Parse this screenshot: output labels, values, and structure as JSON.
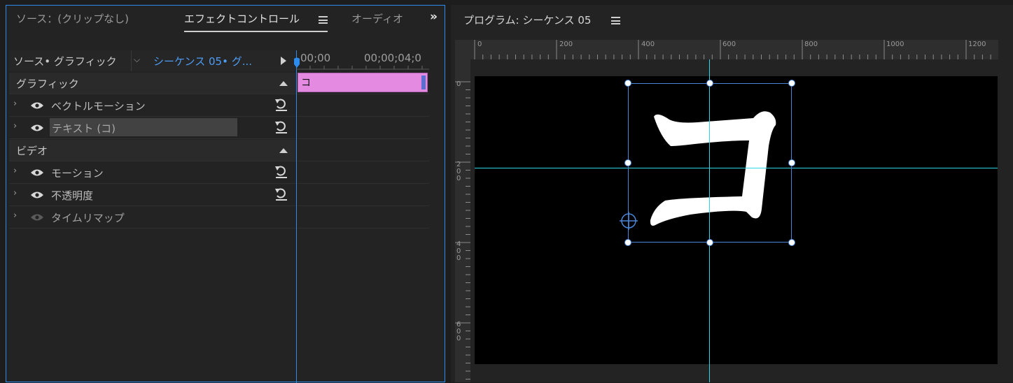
{
  "effect_panel": {
    "tabs": [
      {
        "label": "ソース：(クリップなし)"
      },
      {
        "label": "エフェクトコントロール"
      },
      {
        "label": "オーディオ"
      }
    ],
    "overflow_icon": "double-chevron-right",
    "source_label": "ソース• グラフィック",
    "sequence_label": "シーケンス 05• グ...",
    "timecode_start": "00;00",
    "timecode_end": "00;00;04;0",
    "clip_label": "コ",
    "clip_color": "#e48ae0",
    "sections": [
      {
        "label": "グラフィック",
        "items": [
          {
            "label": "ベクトルモーション"
          },
          {
            "label": "テキスト (コ)"
          }
        ]
      },
      {
        "label": "ビデオ",
        "items": [
          {
            "label": "モーション"
          },
          {
            "label": "不透明度"
          },
          {
            "label": "タイムリマップ"
          }
        ]
      }
    ]
  },
  "program_monitor": {
    "title": "プログラム: シーケンス 05",
    "ruler_h": [
      "0",
      "200",
      "400",
      "600",
      "800",
      "1000",
      "1200"
    ],
    "ruler_v": [
      "0",
      "2\n0\n0",
      "4\n0\n0",
      "6\n0\n0"
    ],
    "canvas_text": "コ",
    "guide_color": "#2fd6e8",
    "selection_color": "#4a86d8"
  }
}
